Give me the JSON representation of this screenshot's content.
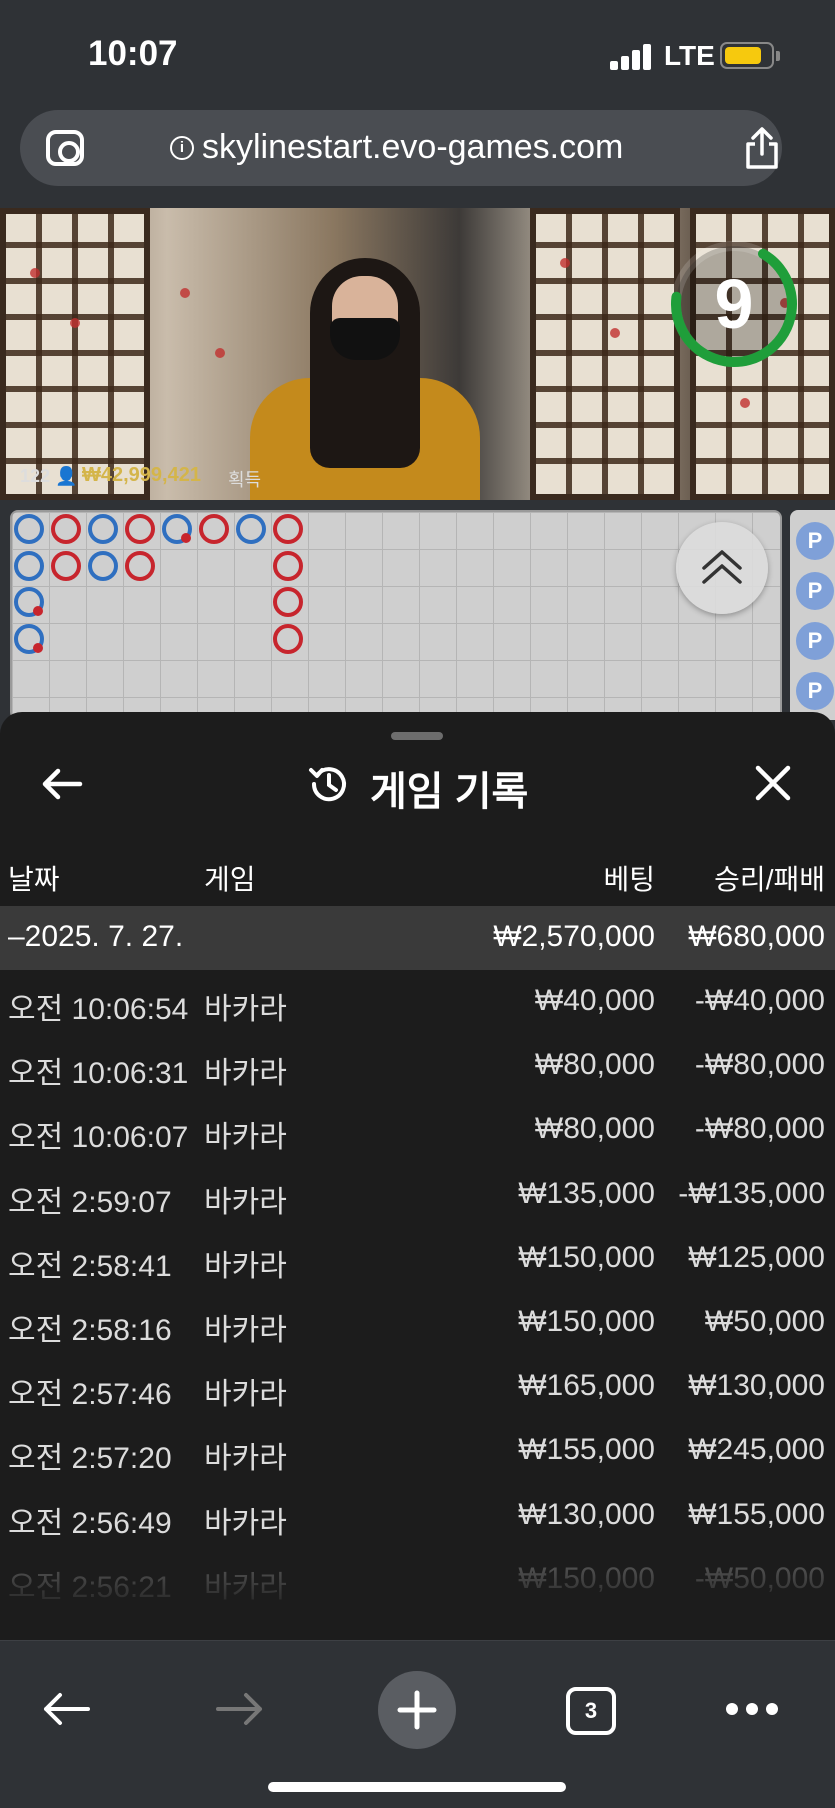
{
  "status_bar": {
    "time": "10:07",
    "network": "LTE"
  },
  "browser": {
    "url": "skylinestart.evo-games.com",
    "tab_count": "3"
  },
  "video": {
    "timer": "9",
    "player_count": "122",
    "win_amount": "₩42,999,421",
    "win_label": "획득"
  },
  "road_side": {
    "label": "P"
  },
  "sheet": {
    "title": "게임 기록",
    "columns": {
      "date": "날짜",
      "game": "게임",
      "bet": "베팅",
      "winloss": "승리/패배"
    },
    "date_group": {
      "date": "–2025. 7. 27.",
      "bet_total": "₩2,570,000",
      "winloss_total": "₩680,000"
    },
    "rows": [
      {
        "time": "오전 10:06:54",
        "game": "바카라",
        "bet": "₩40,000",
        "winloss": "-₩40,000"
      },
      {
        "time": "오전 10:06:31",
        "game": "바카라",
        "bet": "₩80,000",
        "winloss": "-₩80,000"
      },
      {
        "time": "오전 10:06:07",
        "game": "바카라",
        "bet": "₩80,000",
        "winloss": "-₩80,000"
      },
      {
        "time": "오전 2:59:07",
        "game": "바카라",
        "bet": "₩135,000",
        "winloss": "-₩135,000"
      },
      {
        "time": "오전 2:58:41",
        "game": "바카라",
        "bet": "₩150,000",
        "winloss": "₩125,000"
      },
      {
        "time": "오전 2:58:16",
        "game": "바카라",
        "bet": "₩150,000",
        "winloss": "₩50,000"
      },
      {
        "time": "오전 2:57:46",
        "game": "바카라",
        "bet": "₩165,000",
        "winloss": "₩130,000"
      },
      {
        "time": "오전 2:57:20",
        "game": "바카라",
        "bet": "₩155,000",
        "winloss": "₩245,000"
      },
      {
        "time": "오전 2:56:49",
        "game": "바카라",
        "bet": "₩130,000",
        "winloss": "₩155,000"
      },
      {
        "time": "오전 2:56:21",
        "game": "바카라",
        "bet": "₩150,000",
        "winloss": "-₩50,000"
      }
    ]
  },
  "colors": {
    "banker": "#c7252d",
    "player": "#2f6fc0",
    "timer_ring": "#1f9e3a",
    "win_amount": "#d4b54a"
  }
}
